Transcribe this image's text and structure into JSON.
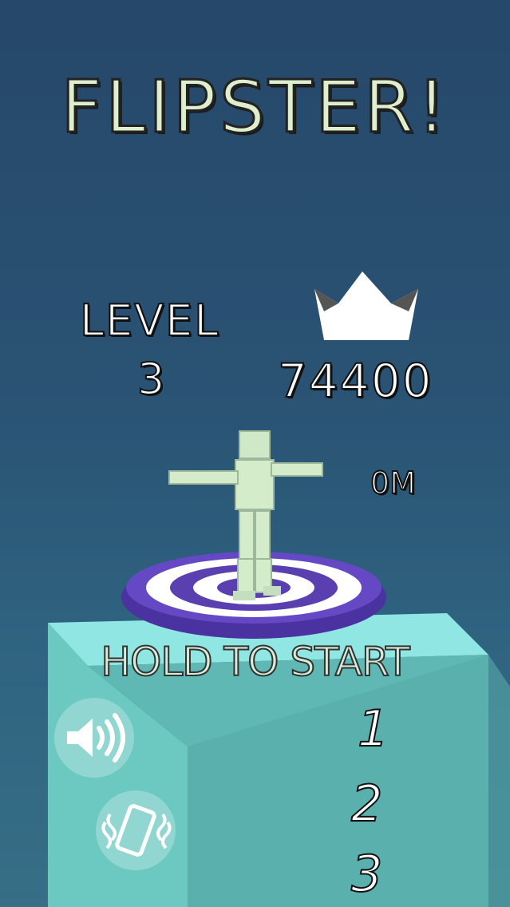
{
  "title": "FLIPSTER!",
  "level": {
    "label": "LEVEL",
    "value": "3"
  },
  "best": {
    "icon": "crown-icon",
    "score": "74400"
  },
  "distance": "0M",
  "prompt": "HOLD TO START",
  "controls": {
    "sound_icon": "speaker-icon",
    "vibration_icon": "vibrate-phone-icon"
  },
  "queue": [
    "1",
    "2",
    "3"
  ],
  "colors": {
    "platform_purple": "#5a3fb0",
    "tower_top": "#8fe8e4",
    "tower_side": "#5bbdb7",
    "title_fill": "#dfeecd"
  }
}
